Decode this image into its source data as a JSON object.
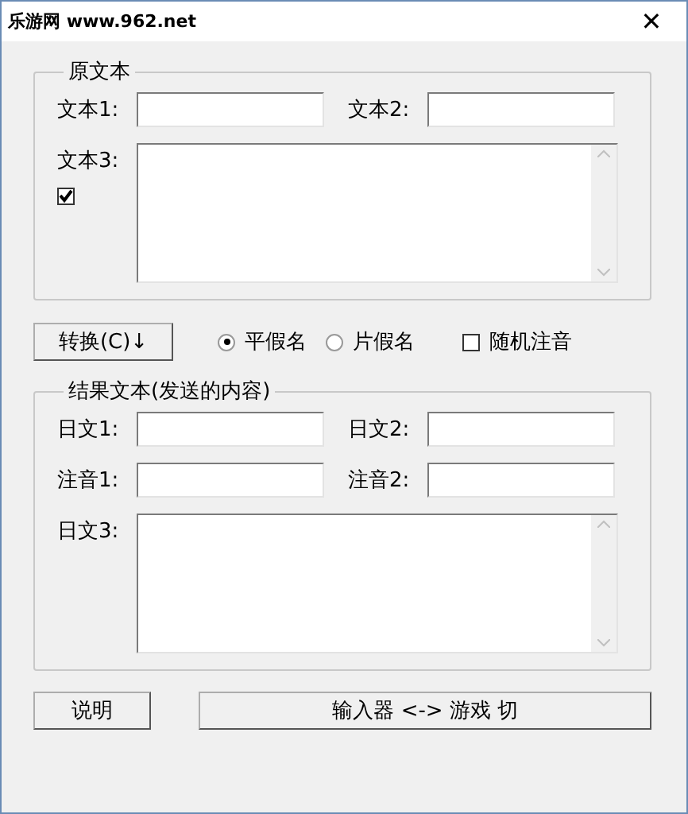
{
  "window": {
    "title": "乐游网 www.962.net",
    "close": "✕"
  },
  "source_group": {
    "title": "原文本",
    "fields": [
      {
        "label": "文本1:"
      },
      {
        "label": "文本2:"
      }
    ],
    "textarea": {
      "label": "文本3:",
      "checked": true
    }
  },
  "convert_button": "转换(C)↓",
  "options": [
    {
      "kind": "radio",
      "label": "平假名",
      "selected": true
    },
    {
      "kind": "radio",
      "label": "片假名",
      "selected": false
    },
    {
      "kind": "checkbox",
      "label": "随机注音",
      "checked": false
    }
  ],
  "result_group": {
    "title": "结果文本(发送的内容)",
    "rows": [
      [
        {
          "label": "日文1:"
        },
        {
          "label": "日文2:"
        }
      ],
      [
        {
          "label": "注音1:"
        },
        {
          "label": "注音2:"
        }
      ]
    ],
    "textarea": {
      "label": "日文3:"
    }
  },
  "buttons": [
    "说明",
    "输入器 <-> 游戏 切"
  ]
}
